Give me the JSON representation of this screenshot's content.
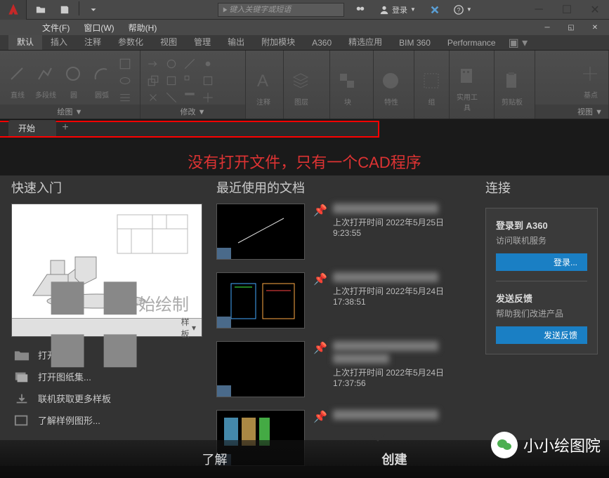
{
  "menu": {
    "file": "文件(F)",
    "window": "窗口(W)",
    "help": "帮助(H)"
  },
  "search_placeholder": "键入关键字或短语",
  "login_label": "登录",
  "ribbon_tabs": [
    "默认",
    "插入",
    "注释",
    "参数化",
    "视图",
    "管理",
    "输出",
    "附加模块",
    "A360",
    "精选应用",
    "BIM 360",
    "Performance"
  ],
  "ribbon": {
    "draw": {
      "title": "绘图 ▼",
      "line": "直线",
      "polyline": "多段线",
      "circle": "圆",
      "arc": "圆弧"
    },
    "modify": {
      "title": "修改 ▼"
    },
    "annotate": "注释",
    "layer": "图层",
    "block": "块",
    "properties": "特性",
    "group": "组",
    "tools": "实用工具",
    "clipboard": "剪贴板",
    "base": "基点",
    "view": "视图 ▼"
  },
  "doc_tabs": {
    "start": "开始"
  },
  "warning": "没有打开文件，只有一个CAD程序",
  "start_page": {
    "quick_start": "快速入门",
    "start_drawing": "开始绘制",
    "template": "样板",
    "open_files": "打开文件...",
    "open_sheets": "打开图纸集...",
    "online_templates": "联机获取更多样板",
    "sample_drawings": "了解样例图形...",
    "recent_title": "最近使用的文档",
    "recent": [
      {
        "time": "上次打开时间 2022年5月25日 9:23:55"
      },
      {
        "time": "上次打开时间 2022年5月24日 17:38:51"
      },
      {
        "time": "上次打开时间 2022年5月24日 17:37:56"
      }
    ],
    "connect": "连接",
    "a360_title": "登录到 A360",
    "a360_desc": "访问联机服务",
    "a360_btn": "登录...",
    "feedback_title": "发送反馈",
    "feedback_desc": "帮助我们改进产品",
    "feedback_btn": "发送反馈"
  },
  "bottom_nav": {
    "learn": "了解",
    "create": "创建"
  },
  "watermark": "小小绘图院"
}
